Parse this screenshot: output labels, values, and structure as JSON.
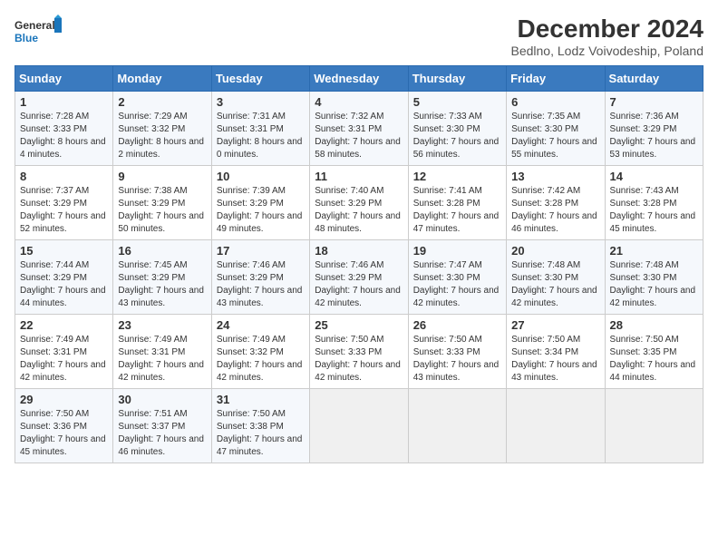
{
  "logo": {
    "line1": "General",
    "line2": "Blue"
  },
  "title": "December 2024",
  "subtitle": "Bedlno, Lodz Voivodeship, Poland",
  "days_of_week": [
    "Sunday",
    "Monday",
    "Tuesday",
    "Wednesday",
    "Thursday",
    "Friday",
    "Saturday"
  ],
  "weeks": [
    [
      {
        "day": "1",
        "sunrise": "Sunrise: 7:28 AM",
        "sunset": "Sunset: 3:33 PM",
        "daylight": "Daylight: 8 hours and 4 minutes."
      },
      {
        "day": "2",
        "sunrise": "Sunrise: 7:29 AM",
        "sunset": "Sunset: 3:32 PM",
        "daylight": "Daylight: 8 hours and 2 minutes."
      },
      {
        "day": "3",
        "sunrise": "Sunrise: 7:31 AM",
        "sunset": "Sunset: 3:31 PM",
        "daylight": "Daylight: 8 hours and 0 minutes."
      },
      {
        "day": "4",
        "sunrise": "Sunrise: 7:32 AM",
        "sunset": "Sunset: 3:31 PM",
        "daylight": "Daylight: 7 hours and 58 minutes."
      },
      {
        "day": "5",
        "sunrise": "Sunrise: 7:33 AM",
        "sunset": "Sunset: 3:30 PM",
        "daylight": "Daylight: 7 hours and 56 minutes."
      },
      {
        "day": "6",
        "sunrise": "Sunrise: 7:35 AM",
        "sunset": "Sunset: 3:30 PM",
        "daylight": "Daylight: 7 hours and 55 minutes."
      },
      {
        "day": "7",
        "sunrise": "Sunrise: 7:36 AM",
        "sunset": "Sunset: 3:29 PM",
        "daylight": "Daylight: 7 hours and 53 minutes."
      }
    ],
    [
      {
        "day": "8",
        "sunrise": "Sunrise: 7:37 AM",
        "sunset": "Sunset: 3:29 PM",
        "daylight": "Daylight: 7 hours and 52 minutes."
      },
      {
        "day": "9",
        "sunrise": "Sunrise: 7:38 AM",
        "sunset": "Sunset: 3:29 PM",
        "daylight": "Daylight: 7 hours and 50 minutes."
      },
      {
        "day": "10",
        "sunrise": "Sunrise: 7:39 AM",
        "sunset": "Sunset: 3:29 PM",
        "daylight": "Daylight: 7 hours and 49 minutes."
      },
      {
        "day": "11",
        "sunrise": "Sunrise: 7:40 AM",
        "sunset": "Sunset: 3:29 PM",
        "daylight": "Daylight: 7 hours and 48 minutes."
      },
      {
        "day": "12",
        "sunrise": "Sunrise: 7:41 AM",
        "sunset": "Sunset: 3:28 PM",
        "daylight": "Daylight: 7 hours and 47 minutes."
      },
      {
        "day": "13",
        "sunrise": "Sunrise: 7:42 AM",
        "sunset": "Sunset: 3:28 PM",
        "daylight": "Daylight: 7 hours and 46 minutes."
      },
      {
        "day": "14",
        "sunrise": "Sunrise: 7:43 AM",
        "sunset": "Sunset: 3:28 PM",
        "daylight": "Daylight: 7 hours and 45 minutes."
      }
    ],
    [
      {
        "day": "15",
        "sunrise": "Sunrise: 7:44 AM",
        "sunset": "Sunset: 3:29 PM",
        "daylight": "Daylight: 7 hours and 44 minutes."
      },
      {
        "day": "16",
        "sunrise": "Sunrise: 7:45 AM",
        "sunset": "Sunset: 3:29 PM",
        "daylight": "Daylight: 7 hours and 43 minutes."
      },
      {
        "day": "17",
        "sunrise": "Sunrise: 7:46 AM",
        "sunset": "Sunset: 3:29 PM",
        "daylight": "Daylight: 7 hours and 43 minutes."
      },
      {
        "day": "18",
        "sunrise": "Sunrise: 7:46 AM",
        "sunset": "Sunset: 3:29 PM",
        "daylight": "Daylight: 7 hours and 42 minutes."
      },
      {
        "day": "19",
        "sunrise": "Sunrise: 7:47 AM",
        "sunset": "Sunset: 3:30 PM",
        "daylight": "Daylight: 7 hours and 42 minutes."
      },
      {
        "day": "20",
        "sunrise": "Sunrise: 7:48 AM",
        "sunset": "Sunset: 3:30 PM",
        "daylight": "Daylight: 7 hours and 42 minutes."
      },
      {
        "day": "21",
        "sunrise": "Sunrise: 7:48 AM",
        "sunset": "Sunset: 3:30 PM",
        "daylight": "Daylight: 7 hours and 42 minutes."
      }
    ],
    [
      {
        "day": "22",
        "sunrise": "Sunrise: 7:49 AM",
        "sunset": "Sunset: 3:31 PM",
        "daylight": "Daylight: 7 hours and 42 minutes."
      },
      {
        "day": "23",
        "sunrise": "Sunrise: 7:49 AM",
        "sunset": "Sunset: 3:31 PM",
        "daylight": "Daylight: 7 hours and 42 minutes."
      },
      {
        "day": "24",
        "sunrise": "Sunrise: 7:49 AM",
        "sunset": "Sunset: 3:32 PM",
        "daylight": "Daylight: 7 hours and 42 minutes."
      },
      {
        "day": "25",
        "sunrise": "Sunrise: 7:50 AM",
        "sunset": "Sunset: 3:33 PM",
        "daylight": "Daylight: 7 hours and 42 minutes."
      },
      {
        "day": "26",
        "sunrise": "Sunrise: 7:50 AM",
        "sunset": "Sunset: 3:33 PM",
        "daylight": "Daylight: 7 hours and 43 minutes."
      },
      {
        "day": "27",
        "sunrise": "Sunrise: 7:50 AM",
        "sunset": "Sunset: 3:34 PM",
        "daylight": "Daylight: 7 hours and 43 minutes."
      },
      {
        "day": "28",
        "sunrise": "Sunrise: 7:50 AM",
        "sunset": "Sunset: 3:35 PM",
        "daylight": "Daylight: 7 hours and 44 minutes."
      }
    ],
    [
      {
        "day": "29",
        "sunrise": "Sunrise: 7:50 AM",
        "sunset": "Sunset: 3:36 PM",
        "daylight": "Daylight: 7 hours and 45 minutes."
      },
      {
        "day": "30",
        "sunrise": "Sunrise: 7:51 AM",
        "sunset": "Sunset: 3:37 PM",
        "daylight": "Daylight: 7 hours and 46 minutes."
      },
      {
        "day": "31",
        "sunrise": "Sunrise: 7:50 AM",
        "sunset": "Sunset: 3:38 PM",
        "daylight": "Daylight: 7 hours and 47 minutes."
      },
      null,
      null,
      null,
      null
    ]
  ]
}
